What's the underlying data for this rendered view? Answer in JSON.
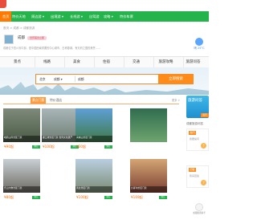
{
  "nav": {
    "items": [
      {
        "label": "首页"
      },
      {
        "label": "特价天地"
      },
      {
        "label": "周边游 ▾"
      },
      {
        "label": "出境游 ▾"
      },
      {
        "label": "长线游 ▾"
      },
      {
        "label": "自驾游"
      },
      {
        "label": "攻略 ▾"
      },
      {
        "label": "特价车票"
      }
    ]
  },
  "breadcrumb": "首页 > 成都 > 成都旅游",
  "city": {
    "title": "成都",
    "tag": "世界美食之都",
    "desc": "成都位于四川省中部，是中国西南重要的中心城市，古称蓉城，有天府之国的美誉……"
  },
  "weather": {
    "temp": "晴 25°C"
  },
  "categories": [
    "景点",
    "线路",
    "美食",
    "住宿",
    "交通",
    "旅游攻略",
    "旅游问答"
  ],
  "search": {
    "region": "北京",
    "type": "成都 ▾",
    "query": "成都",
    "button": "立即搜索"
  },
  "tabs": [
    "景点门票",
    "特价酒店"
  ],
  "more": "更多 >",
  "cards": [
    {
      "caption": "峨眉山风景区门票",
      "price": "¥90起",
      "tag": "预订"
    },
    {
      "caption": "都江堰景区门票 世界文化遗产",
      "price": "¥100起",
      "tag": "预订"
    },
    {
      "caption": "青城山景区门票",
      "price": "¥30起",
      "tag": "预订"
    },
    {
      "caption": "",
      "price": "",
      "tag": ""
    },
    {
      "caption": "乐山大佛景区门票",
      "price": "¥80起",
      "tag": "预订"
    },
    {
      "caption": "黄龙景区门票",
      "price": "¥100起",
      "tag": "预订"
    },
    {
      "caption": "九寨沟景区门票",
      "price": "¥169起",
      "tag": "预订"
    },
    {
      "caption": "",
      "price": "",
      "tag": ""
    }
  ],
  "rail": {
    "banner": "旅游问答",
    "banner_badge": "提问",
    "title": "成都旅游问答",
    "boxes": [
      {
        "label": "提问",
        "q": "我要提问"
      },
      {
        "label": "回答",
        "q": "我来回答"
      }
    ],
    "helper": "成都旅游助手"
  }
}
